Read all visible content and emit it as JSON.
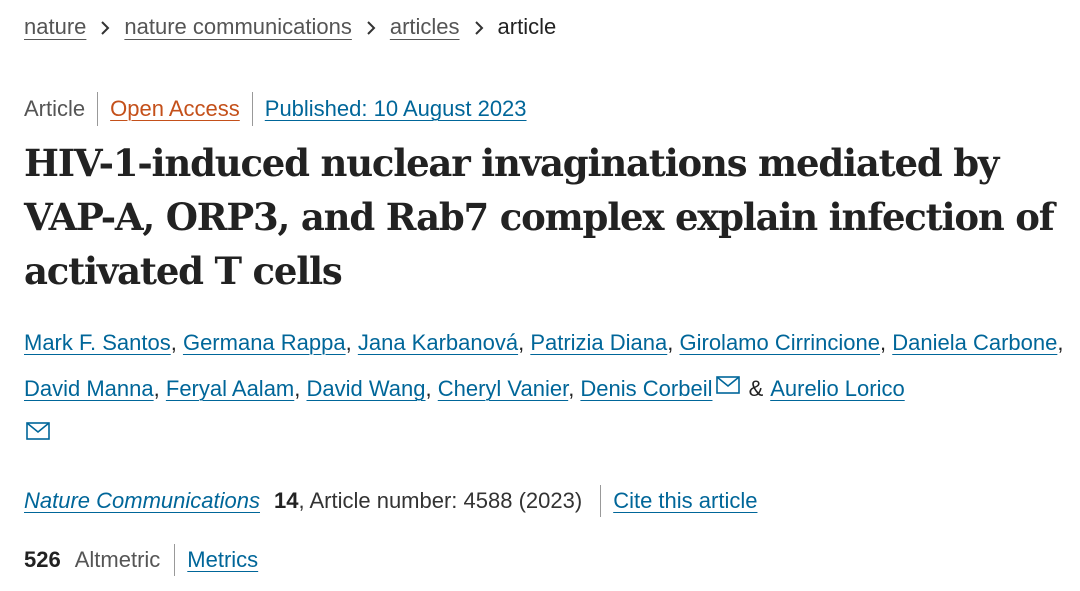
{
  "breadcrumb": {
    "items": [
      "nature",
      "nature communications",
      "articles"
    ],
    "current": "article",
    "separator_icon": "chevron-right-icon"
  },
  "meta": {
    "type": "Article",
    "access": "Open Access",
    "published": "Published: 10 August 2023"
  },
  "title": "HIV-1-induced nuclear invaginations mediated by VAP-A, ORP3, and Rab7 complex explain infection of activated T cells",
  "authors": [
    "Mark F. Santos",
    "Germana Rappa",
    "Jana Karbanová",
    "Patrizia Diana",
    "Girolamo Cirrincione",
    "Daniela Carbone",
    "David Manna",
    "Feryal Aalam",
    "David Wang",
    "Cheryl Vanier",
    "Denis Corbeil",
    "Aurelio Lorico"
  ],
  "authors_connector": "&",
  "citation": {
    "journal": "Nature Communications",
    "volume": "14",
    "article_number": ", Article number: 4588 (2023)",
    "cite_label": "Cite this article"
  },
  "metrics": {
    "altmetric_count": "526",
    "altmetric_label": "Altmetric",
    "metrics_label": "Metrics"
  },
  "colors": {
    "link": "#006699",
    "open_access": "#c4501a",
    "text": "#222222"
  }
}
